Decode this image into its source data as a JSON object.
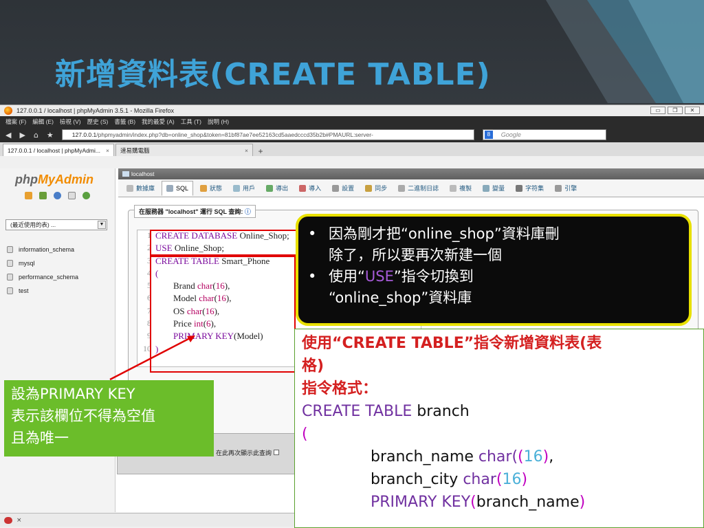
{
  "slide": {
    "title": "新增資料表(CREATE TABLE)"
  },
  "browser": {
    "window_title": "127.0.0.1 / localhost | phpMyAdmin 3.5.1 - Mozilla Firefox",
    "menu": [
      "檔案 (F)",
      "編輯 (E)",
      "檢視 (V)",
      "歷史 (S)",
      "書籤 (B)",
      "我的最愛 (A)",
      "工具 (T)",
      "說明 (H)"
    ],
    "url_host": "127.0.0.1",
    "url_rest": "/phpmyadmin/index.php?db=online_shop&token=81bf87ae7ee52163cd5aaedcccd35b2b#PMAURL:server-",
    "search_placeholder": "Google",
    "tabs": [
      {
        "label": "127.0.0.1 / localhost | phpMyAdmi...",
        "active": true
      },
      {
        "label": "速易購電腦",
        "active": false
      }
    ]
  },
  "pma": {
    "logo_php": "php",
    "logo_myadmin": "MyAdmin",
    "recent_select": "(最近使用的表) ...",
    "databases": [
      "information_schema",
      "mysql",
      "performance_schema",
      "test"
    ],
    "server_label": "localhost",
    "main_tabs": [
      {
        "label": "數據庫",
        "active": false
      },
      {
        "label": "SQL",
        "active": true
      },
      {
        "label": "狀態",
        "active": false
      },
      {
        "label": "用戶",
        "active": false
      },
      {
        "label": "導出",
        "active": false
      },
      {
        "label": "導入",
        "active": false
      },
      {
        "label": "設置",
        "active": false
      },
      {
        "label": "同步",
        "active": false
      },
      {
        "label": "二進制日誌",
        "active": false
      },
      {
        "label": "複製",
        "active": false
      },
      {
        "label": "變量",
        "active": false
      },
      {
        "label": "字符集",
        "active": false
      },
      {
        "label": "引擎",
        "active": false
      }
    ],
    "query_legend": "在服務器 \"localhost\" 運行 SQL 查詢:",
    "show_again_label": "在此再次顯示此查詢"
  },
  "sql_lines": [
    {
      "n": "1",
      "parts": [
        [
          "kw",
          "CREATE DATABASE"
        ],
        [
          "plain",
          " Online_Shop;"
        ]
      ]
    },
    {
      "n": "2",
      "parts": [
        [
          "kw",
          "USE"
        ],
        [
          "plain",
          " Online_Shop;"
        ]
      ]
    },
    {
      "n": "3",
      "parts": [
        [
          "kw",
          "CREATE TABLE"
        ],
        [
          "plain",
          " Smart_Phone"
        ]
      ]
    },
    {
      "n": "4",
      "parts": [
        [
          "kw",
          "("
        ]
      ]
    },
    {
      "n": "5",
      "parts": [
        [
          "plain",
          "        Brand "
        ],
        [
          "fn",
          "char"
        ],
        [
          "plain",
          "("
        ],
        [
          "num",
          "16"
        ],
        [
          "plain",
          "),"
        ]
      ]
    },
    {
      "n": "6",
      "parts": [
        [
          "plain",
          "        Model "
        ],
        [
          "fn",
          "char"
        ],
        [
          "plain",
          "("
        ],
        [
          "num",
          "16"
        ],
        [
          "plain",
          "),"
        ]
      ]
    },
    {
      "n": "7",
      "parts": [
        [
          "plain",
          "        OS "
        ],
        [
          "fn",
          "char"
        ],
        [
          "plain",
          "("
        ],
        [
          "num",
          "16"
        ],
        [
          "plain",
          "),"
        ]
      ]
    },
    {
      "n": "8",
      "parts": [
        [
          "plain",
          "        Price "
        ],
        [
          "fn",
          "int"
        ],
        [
          "plain",
          "("
        ],
        [
          "num",
          "6"
        ],
        [
          "plain",
          "),"
        ]
      ]
    },
    {
      "n": "9",
      "parts": [
        [
          "plain",
          "        "
        ],
        [
          "kw",
          "PRIMARY KEY"
        ],
        [
          "plain",
          "(Model)"
        ]
      ]
    },
    {
      "n": "10",
      "parts": [
        [
          "kw",
          ")"
        ]
      ]
    }
  ],
  "callout": {
    "bullet1_line1": "因為剛才把“online_shop”資料庫刪",
    "bullet1_line2": "除了，所以要再次新建一個",
    "bullet2_pre": "使用“",
    "bullet2_use": "USE",
    "bullet2_post": "”指令切換到",
    "bullet2_line2": "“online_shop”資料庫"
  },
  "explain": {
    "line1": "使用“CREATE TABLE”指令新增資料表(表",
    "line2": "格)",
    "line3": "指令格式：",
    "kw_create_table": "CREATE TABLE",
    "table_name": " branch",
    "open_paren": "(",
    "col1_name": "branch_name ",
    "col1_type": "char",
    "col1_p1": "(",
    "col1_p2": "(",
    "col1_len": "16",
    "col1_p3": ")",
    "col1_end": ",",
    "col2_name": "branch_city ",
    "col2_type": "char",
    "col2_p1": "(",
    "col2_len": "16",
    "col2_p2": ")",
    "pk_kw": "PRIMARY KEY",
    "pk_p1": "(",
    "pk_col": "branch_name",
    "pk_p2": ")"
  },
  "note": {
    "line1": "設為PRIMARY KEY",
    "line2": "表示該欄位不得為空值",
    "line3": "且為唯一"
  },
  "colors": {
    "title": "#3fa3d8",
    "callout_border": "#e8e000",
    "red_highlight": "#e00000",
    "note_bg": "#6bbd2a"
  }
}
